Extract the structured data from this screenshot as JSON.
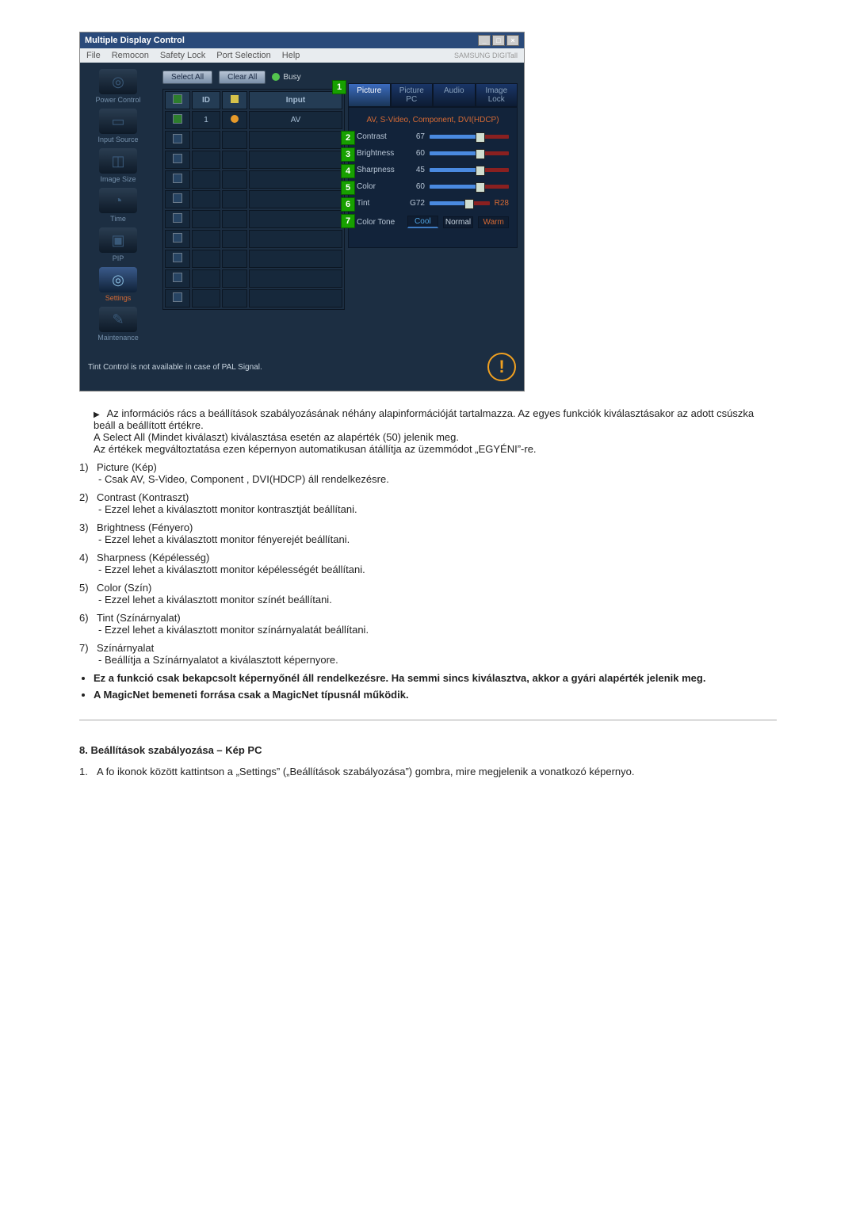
{
  "window": {
    "title": "Multiple Display Control",
    "menu": [
      "File",
      "Remocon",
      "Safety Lock",
      "Port Selection",
      "Help"
    ],
    "brand": "SAMSUNG DIGITall"
  },
  "sidebar": [
    {
      "label": "Power Control",
      "icon": "◎"
    },
    {
      "label": "Input Source",
      "icon": "▭"
    },
    {
      "label": "Image Size",
      "icon": "◫"
    },
    {
      "label": "Time",
      "icon": "◔"
    },
    {
      "label": "PIP",
      "icon": "▣"
    },
    {
      "label": "Settings",
      "icon": "◎",
      "selected": true
    },
    {
      "label": "Maintenance",
      "icon": "✎"
    }
  ],
  "topbar": {
    "select_all": "Select All",
    "clear_all": "Clear All",
    "busy": "Busy"
  },
  "grid": {
    "headers": [
      "",
      "ID",
      "",
      "Input"
    ],
    "rows": [
      {
        "sel": true,
        "id": "1",
        "dot": true,
        "input": "AV"
      },
      {},
      {
        "": ""
      },
      {},
      {
        "": ""
      },
      {},
      {
        "": ""
      },
      {},
      {
        "": ""
      },
      {},
      {
        "": ""
      }
    ]
  },
  "panel": {
    "tabs": [
      "Picture",
      "Picture PC",
      "Audio",
      "Image Lock"
    ],
    "active": 0,
    "header": "AV, S-Video, Component, DVI(HDCP)",
    "sliders": [
      {
        "num": "2",
        "label": "Contrast",
        "value": "67"
      },
      {
        "num": "3",
        "label": "Brightness",
        "value": "60"
      },
      {
        "num": "4",
        "label": "Sharpness",
        "value": "45"
      },
      {
        "num": "5",
        "label": "Color",
        "value": "60"
      },
      {
        "num": "6",
        "label": "Tint",
        "value": "G72",
        "right": "R28"
      }
    ],
    "tone": {
      "num": "7",
      "label": "Color Tone",
      "options": [
        "Cool",
        "Normal",
        "Warm"
      ]
    }
  },
  "footer": "Tint Control is not available in case of PAL Signal.",
  "doc": {
    "intro": [
      "Az információs rács a beállítások szabályozásának néhány alapinformációját tartalmazza. Az egyes funkciók kiválasztásakor az adott csúszka beáll a beállított értékre.",
      "A Select All (Mindet kiválaszt) kiválasztása esetén az alapérték (50) jelenik meg.",
      "Az értékek megváltoztatása ezen képernyon automatikusan átállítja az üzemmódot „EGYÉNI”-re."
    ],
    "items": [
      {
        "n": "1)",
        "t": "Picture (Kép)",
        "s": "- Csak AV, S-Video, Component , DVI(HDCP) áll rendelkezésre."
      },
      {
        "n": "2)",
        "t": "Contrast (Kontraszt)",
        "s": "- Ezzel lehet a kiválasztott monitor kontrasztját beállítani."
      },
      {
        "n": "3)",
        "t": "Brightness (Fényero)",
        "s": "- Ezzel lehet a kiválasztott monitor fényerejét beállítani."
      },
      {
        "n": "4)",
        "t": "Sharpness (Képélesség)",
        "s": "- Ezzel lehet a kiválasztott monitor képélességét beállítani."
      },
      {
        "n": "5)",
        "t": "Color (Szín)",
        "s": "- Ezzel lehet a kiválasztott monitor színét beállítani."
      },
      {
        "n": "6)",
        "t": "Tint (Színárnyalat)",
        "s": "- Ezzel lehet a kiválasztott monitor színárnyalatát beállítani."
      },
      {
        "n": "7)",
        "t": "Színárnyalat",
        "s": "- Beállítja a Színárnyalatot a kiválasztott képernyore."
      }
    ],
    "bullets": [
      "Ez a funkció csak bekapcsolt képernyőnél áll rendelkezésre. Ha semmi sincs kiválasztva, akkor a gyári alapérték jelenik meg.",
      "A MagicNet bemeneti forrása csak a MagicNet típusnál működik."
    ],
    "section8": {
      "title": "8. Beállítások szabályozása – Kép PC",
      "step1_n": "1.",
      "step1": "A fo ikonok között kattintson a „Settings” („Beállítások szabályozása”) gombra, mire megjelenik a vonatkozó képernyo."
    }
  }
}
